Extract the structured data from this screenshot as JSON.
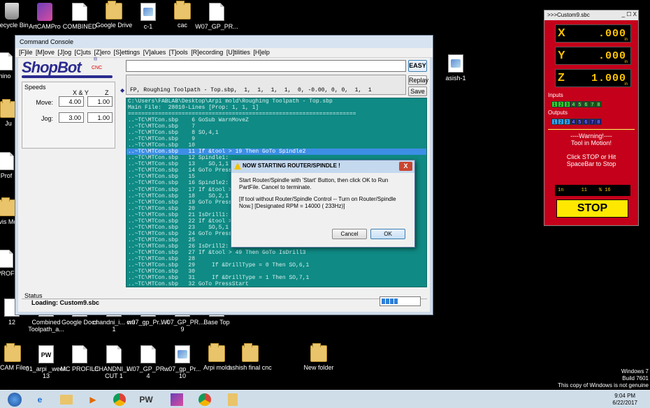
{
  "desktop": {
    "icons": [
      {
        "label": "Recycle Bin",
        "type": "bin"
      },
      {
        "label": "ArtCAMPro",
        "type": "app"
      },
      {
        "label": "COMBINED",
        "type": "doc"
      },
      {
        "label": "Google Drive",
        "type": "folder"
      },
      {
        "label": "c-1",
        "type": "sbp"
      },
      {
        "label": "cac",
        "type": "folder"
      },
      {
        "label": "W07_GP_PR...",
        "type": "doc"
      },
      {
        "label": "asish-1",
        "type": "sbp"
      },
      {
        "label": "hino",
        "type": "doc"
      },
      {
        "label": "Ju",
        "type": "folder"
      },
      {
        "label": "Prof",
        "type": "doc"
      },
      {
        "label": "Avis Mou",
        "type": "folder"
      },
      {
        "label": "PROF",
        "type": "doc"
      },
      {
        "label": "12",
        "type": "doc"
      },
      {
        "label": "Combined Toolpath_a...",
        "type": "doc"
      },
      {
        "label": "Google Docs",
        "type": "doc"
      },
      {
        "label": "chandni_i... cut 1",
        "type": "doc"
      },
      {
        "label": "w07_gp_Pr... 4",
        "type": "doc"
      },
      {
        "label": "W07_GP_PR... 9",
        "type": "doc"
      },
      {
        "label": "Base Top",
        "type": "doc"
      },
      {
        "label": "rtCAM Files",
        "type": "folder"
      },
      {
        "label": "01_arpi _week 13",
        "type": "pw"
      },
      {
        "label": "MC PROFILE",
        "type": "doc"
      },
      {
        "label": "CHANDNI_I... CUT 1",
        "type": "doc"
      },
      {
        "label": "W07_GP_PR... 4",
        "type": "doc"
      },
      {
        "label": "w07_gp_Pr... 10",
        "type": "sbp"
      },
      {
        "label": "Arpi mold",
        "type": "folder"
      },
      {
        "label": "ashish final cnc",
        "type": "folder"
      },
      {
        "label": "New folder",
        "type": "folder"
      }
    ],
    "windows_label": {
      "line1": "Windows 7",
      "line2": "Build 7601",
      "line3": "This copy of Windows is not genuine"
    }
  },
  "console": {
    "title": "Command Console",
    "menu": [
      "[F]ile",
      "[M]ove",
      "[J]og",
      "[C]uts",
      "[Z]ero",
      "[S]ettings",
      "[V]alues",
      "[T]ools",
      "[R]ecording",
      "[U]tilities",
      "[H]elp"
    ],
    "logo": {
      "name": "ShopBot",
      "sub": "CNC",
      "tm": "®"
    },
    "easy_label": "EASY",
    "replay_label": "Replay",
    "save_label": "Save",
    "file_line": "FP, Roughing Toolpath - Top.sbp,  1,  1,  1,  1,  0, -0.00, 0, 0,  1,  1",
    "speeds": {
      "title": "Speeds",
      "col_xy": "X & Y",
      "col_z": "Z",
      "move_label": "Move:",
      "jog_label": "Jog:",
      "move_xy": "4.00",
      "move_z": "1.00",
      "jog_xy": "3.00",
      "jog_z": "1.00"
    },
    "code": {
      "path": "C:\\Users\\FABLAB\\Desktop\\Arpi mold\\Roughing Toolpath - Top.sbp",
      "main_file": "Main File:  28010-Lines [Prop: 1, 1, 1]",
      "separator": "====================================================================",
      "lines": [
        "..~TC\\MTCon.sbp    6 GoSub WarnMoveZ",
        "..~TC\\MTCon.sbp    7",
        "..~TC\\MTCon.sbp    8 SO,4,1",
        "..~TC\\MTCon.sbp    9",
        "..~TC\\MTCon.sbp   10",
        "..~TC\\MTCon.sbp   11 If &tool > 19 Then GoTo Spindle2",
        "..~TC\\MTCon.sbp   12 Spindle1:",
        "..~TC\\MTCon.sbp   13    SO,1,1",
        "..~TC\\MTCon.sbp   14 GoTo PressSt",
        "..~TC\\MTCon.sbp   15",
        "..~TC\\MTCon.sbp   16 Spindle2:",
        "..~TC\\MTCon.sbp   17 If &tool > 2",
        "..~TC\\MTCon.sbp   18    SO,2,1",
        "..~TC\\MTCon.sbp   19 GoTo PressSt",
        "..~TC\\MTCon.sbp   20",
        "..~TC\\MTCon.sbp   21 IsDrill1:",
        "..~TC\\MTCon.sbp   22 If &tool > 3",
        "..~TC\\MTCon.sbp   23    SO,5,1",
        "..~TC\\MTCon.sbp   24 GoTo PressSt",
        "..~TC\\MTCon.sbp   25",
        "..~TC\\MTCon.sbp   26 IsDrill2:",
        "..~TC\\MTCon.sbp   27 If &tool > 49 Then GoTo IsDrill3",
        "..~TC\\MTCon.sbp   28",
        "..~TC\\MTCon.sbp   29     If &DrillType = 0 Then SO,6,1",
        "..~TC\\MTCon.sbp   30",
        "..~TC\\MTCon.sbp   31     If &DrillType = 1 Then SO,7,1",
        "..~TC\\MTCon.sbp   32 GoTo PressStart"
      ]
    },
    "status_label": "Status",
    "status_text": "Loading: Custom9.sbc"
  },
  "dialog": {
    "title": "NOW STARTING ROUTER/SPINDLE !",
    "close": "X",
    "message1": "Start Router/Spindle with 'Start' Button, then click OK to Run PartFile. Cancel to terminate.",
    "message2": "[If tool without Router/Spindle Control -- Turn on Router/Spindle Now.]  [Designated RPM = 14000 ( 233Hz)]",
    "cancel_label": "Cancel",
    "ok_label": "OK"
  },
  "dro": {
    "title": ">>>Custom9.sbc",
    "controls": "_ ☐ X",
    "x_label": "X",
    "x_value": ".000",
    "y_label": "Y",
    "y_value": ".000",
    "z_label": "Z",
    "z_value": "1.000",
    "unit": "in",
    "inputs_label": "Inputs",
    "inputs": [
      "1",
      "2",
      "3",
      "4",
      "5",
      "6",
      "7",
      "8"
    ],
    "outputs_label": "Outputs",
    "outputs": [
      "1",
      "2",
      "3",
      "4",
      "5",
      "6",
      "7",
      "8"
    ],
    "warning_title": "----Warning!----",
    "warning_line": "Tool in Motion!",
    "warning_hint": "Click STOP or Hit SpaceBar to Stop",
    "bottom_readout": "1n      11    % 16",
    "stop_label": "STOP"
  },
  "taskbar": {
    "items": [
      "start",
      "ie",
      "explorer",
      "media",
      "chrome",
      "pw",
      "artcam",
      "chrome2",
      "folder"
    ],
    "time": "9:04 PM",
    "date": "6/22/2017"
  },
  "colors": {
    "console_code_bg": "#0f8a84",
    "dro_bg": "#c4001a",
    "stop_bg": "#ffe800",
    "accent": "#3d8ee6"
  }
}
